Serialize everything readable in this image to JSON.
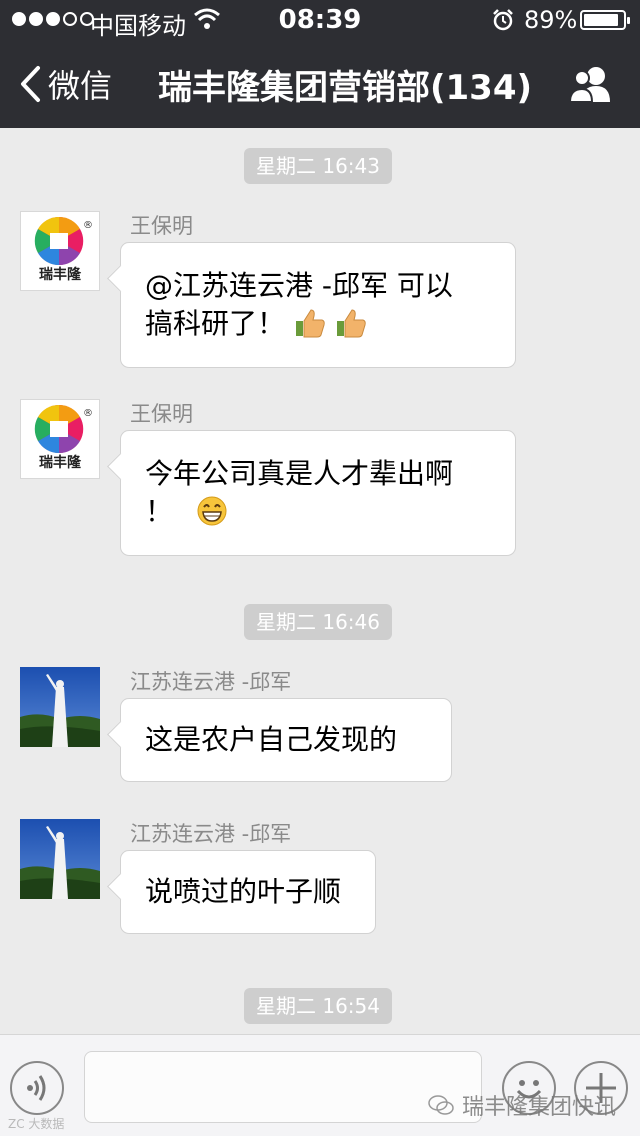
{
  "status_bar": {
    "carrier": "中国移动",
    "time": "08:39",
    "battery": "89%",
    "battery_level": 0.89,
    "icons": [
      "signal-dots",
      "wifi-icon",
      "alarm-icon",
      "battery-icon"
    ]
  },
  "nav": {
    "back_label": "微信",
    "title": "瑞丰隆集团营销部(134)",
    "right_icon": "group-members-icon"
  },
  "logo": {
    "text": "瑞丰隆",
    "reg": "®"
  },
  "messages": [
    {
      "type": "time",
      "text": "星期二 16:43"
    },
    {
      "type": "msg",
      "sender": "王保明",
      "text_line1": "@江苏连云港 -邱军 可以",
      "text_line2": "搞科研了！",
      "emoji": "thumbs-up-icon"
    },
    {
      "type": "msg",
      "sender": "王保明",
      "text_line1": "今年公司真是人才辈出啊",
      "text_line2": "！",
      "emoji": "grinning-face-icon"
    },
    {
      "type": "time",
      "text": "星期二 16:46"
    },
    {
      "type": "msg",
      "sender": "江苏连云港 -邱军",
      "text": "这是农户自己发现的"
    },
    {
      "type": "msg",
      "sender": "江苏连云港 -邱军",
      "text": "说喷过的叶子顺"
    },
    {
      "type": "time",
      "text": "星期二 16:54"
    }
  ],
  "input_bar": {
    "placeholder": "",
    "watermark": "瑞丰隆集团快讯",
    "watermark_left": "ZC 大数据"
  },
  "colors": {
    "nav_bg": "#2d2e33",
    "chat_bg": "#ebebeb",
    "timestamp_bg": "#cecece",
    "bubble_bg": "#ffffff"
  }
}
